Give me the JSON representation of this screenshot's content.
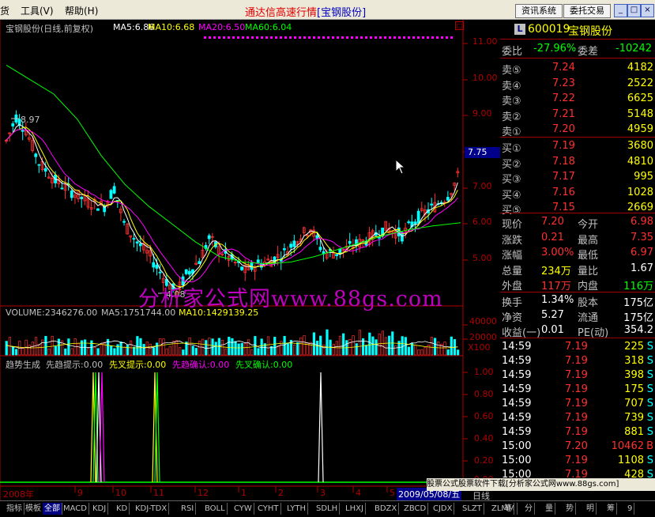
{
  "menu": {
    "partial_left": "货",
    "items": [
      "工具(V)",
      "帮助(H)"
    ]
  },
  "app_title": {
    "text": "通达信高速行情",
    "stock": "[宝钢股份]"
  },
  "top_buttons": [
    "资讯系统",
    "委托交易"
  ],
  "window_controls": [
    "_",
    "□",
    "×"
  ],
  "price_panel": {
    "header": {
      "name": "宝钢股份(日线,前复权)",
      "ma5": "MA5:6.86",
      "ma10": "MA10:6.68",
      "ma20": "MA20:6.50",
      "ma60": "MA60:6.04"
    },
    "yaxis_labels": [
      "11.00",
      "10.00",
      "9.00",
      "8.00",
      "7.00",
      "6.00",
      "5.00"
    ],
    "highlight_price": "7.75",
    "high_marker": "8.97",
    "low_marker": "4.08"
  },
  "volume_panel": {
    "header": {
      "volume": "VOLUME:2346276.00",
      "ma5": "MA5:1751744.00",
      "ma10": "MA10:1429139.25"
    },
    "yaxis_labels": [
      "40000",
      "20000"
    ],
    "unit": "X100"
  },
  "indicator_panel": {
    "header": {
      "name": "趋势生成",
      "l1": "先趋提示:0.00",
      "l2": "先叉提示:0.00",
      "l3": "先趋确认:0.00",
      "l4": "先叉确认:0.00"
    },
    "yaxis_labels": [
      "1.00",
      "0.80",
      "0.60",
      "0.40",
      "0.20",
      "0.00"
    ]
  },
  "date_axis": {
    "labels": [
      "2008年",
      "9",
      "10",
      "11",
      "12",
      "1",
      "2",
      "3",
      "4",
      "5"
    ],
    "current_date": "2009/05/08/五",
    "period": "日线"
  },
  "watermark": "分析家公式网www.88gs.com",
  "promo": "股票公式股票软件下载[分析家公式网www.88gs.com]",
  "quote": {
    "code": "600019",
    "name": "宝钢股份",
    "badge": "L",
    "weibi": {
      "label": "委比",
      "value": "-27.96%",
      "label2": "委差",
      "value2": "-10242"
    },
    "sells": [
      {
        "label": "卖⑤",
        "price": "7.24",
        "vol": "4182"
      },
      {
        "label": "卖④",
        "price": "7.23",
        "vol": "2522"
      },
      {
        "label": "卖③",
        "price": "7.22",
        "vol": "6625"
      },
      {
        "label": "卖②",
        "price": "7.21",
        "vol": "5148"
      },
      {
        "label": "卖①",
        "price": "7.20",
        "vol": "4959"
      }
    ],
    "buys": [
      {
        "label": "买①",
        "price": "7.19",
        "vol": "3680"
      },
      {
        "label": "买②",
        "price": "7.18",
        "vol": "4810"
      },
      {
        "label": "买③",
        "price": "7.17",
        "vol": "995"
      },
      {
        "label": "买④",
        "price": "7.16",
        "vol": "1028"
      },
      {
        "label": "买⑤",
        "price": "7.15",
        "vol": "2669"
      }
    ],
    "stats": [
      {
        "l1": "现价",
        "v1": "7.20",
        "l2": "今开",
        "v2": "6.98"
      },
      {
        "l1": "涨跌",
        "v1": "0.21",
        "l2": "最高",
        "v2": "7.35"
      },
      {
        "l1": "涨幅",
        "v1": "3.00%",
        "l2": "最低",
        "v2": "6.97"
      },
      {
        "l1": "总量",
        "v1": "234万",
        "l2": "量比",
        "v2": "1.67"
      },
      {
        "l1": "外盘",
        "v1": "117万",
        "l2": "内盘",
        "v2": "116万"
      }
    ],
    "finance": [
      {
        "l1": "换手",
        "v1": "1.34%",
        "l2": "股本",
        "v2": "175亿"
      },
      {
        "l1": "净资",
        "v1": "5.27",
        "l2": "流通",
        "v2": "175亿"
      },
      {
        "l1": "收益(一)",
        "v1": "0.01",
        "l2": "PE(动)",
        "v2": "354.2"
      }
    ],
    "ticks": [
      {
        "time": "14:59",
        "price": "7.19",
        "vol": "225",
        "dir": "S"
      },
      {
        "time": "14:59",
        "price": "7.19",
        "vol": "318",
        "dir": "S"
      },
      {
        "time": "14:59",
        "price": "7.19",
        "vol": "398",
        "dir": "S"
      },
      {
        "time": "14:59",
        "price": "7.19",
        "vol": "175",
        "dir": "S"
      },
      {
        "time": "14:59",
        "price": "7.19",
        "vol": "707",
        "dir": "S"
      },
      {
        "time": "14:59",
        "price": "7.19",
        "vol": "739",
        "dir": "S"
      },
      {
        "time": "14:59",
        "price": "7.19",
        "vol": "881",
        "dir": "S"
      },
      {
        "time": "15:00",
        "price": "7.20",
        "vol": "10462",
        "dir": "B"
      },
      {
        "time": "15:00",
        "price": "7.19",
        "vol": "1108",
        "dir": "S"
      },
      {
        "time": "15:00",
        "price": "7.19",
        "vol": "428",
        "dir": "S"
      }
    ]
  },
  "bottom_tabs": [
    "指标",
    "模板",
    "全部",
    "MACD",
    "KDJ",
    "KD",
    "KDJ-TDX",
    "RSI",
    "BOLL",
    "CYW",
    "CYHT",
    "LYTH",
    "SDLH",
    "LHXJ",
    "BDZX",
    "ZBCD",
    "CJDX",
    "SLZT",
    "ZLMM"
  ],
  "bottom_right_tabs": [
    "笔",
    "分",
    "量",
    "势",
    "明",
    "筹",
    "9"
  ],
  "colors": {
    "up": "#ff3030",
    "down": "#00ffff",
    "ma5": "#ffffff",
    "ma10": "#ffff00",
    "ma20": "#ff00ff",
    "ma60": "#00ff00",
    "axis": "#b00000",
    "accent_blue": "#0000c0"
  }
}
